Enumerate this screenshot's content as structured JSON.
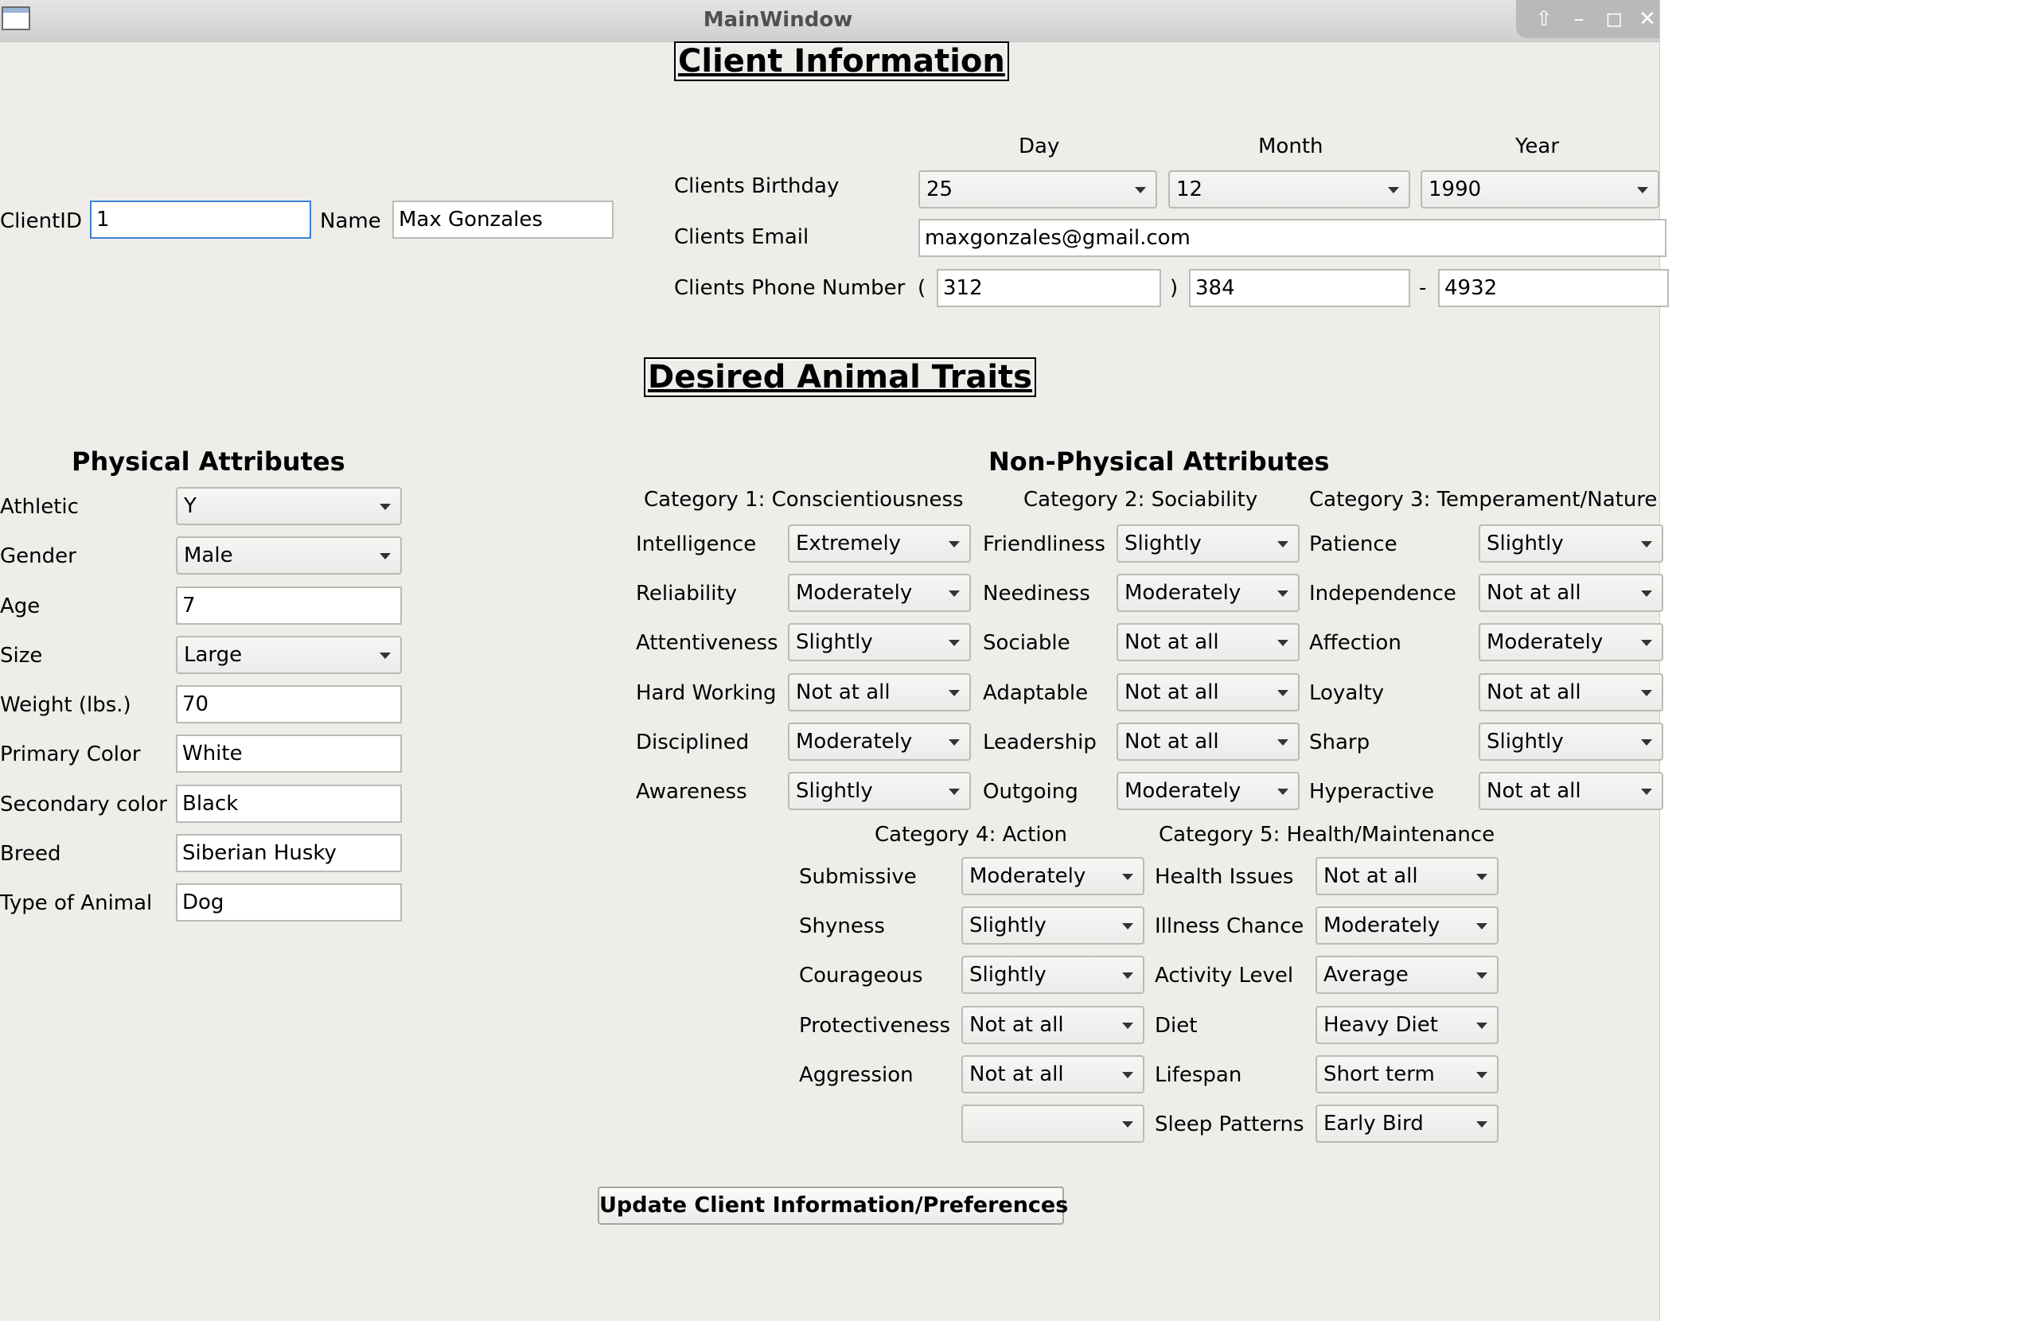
{
  "window": {
    "title": "MainWindow"
  },
  "client_section": {
    "title": "Client Information",
    "client_id_label": "ClientID",
    "client_id_value": "1",
    "name_label": "Name",
    "name_value": "Max Gonzales",
    "day_header": "Day",
    "month_header": "Month",
    "year_header": "Year",
    "birthday_label": "Clients Birthday",
    "birthday_day": "25",
    "birthday_month": "12",
    "birthday_year": "1990",
    "email_label": "Clients Email",
    "email_value": "maxgonzales@gmail.com",
    "phone_label": "Clients Phone Number",
    "phone_open_paren": "(",
    "phone_area": "312",
    "phone_close_paren": ")",
    "phone_prefix": "384",
    "phone_dash": "-",
    "phone_line": "4932"
  },
  "traits_section": {
    "title": "Desired Animal Traits"
  },
  "physical": {
    "title": "Physical Attributes",
    "rows": [
      {
        "label": "Athletic",
        "value": "Y",
        "type": "combo"
      },
      {
        "label": "Gender",
        "value": "Male",
        "type": "combo"
      },
      {
        "label": "Age",
        "value": "7",
        "type": "input"
      },
      {
        "label": "Size",
        "value": "Large",
        "type": "combo"
      },
      {
        "label": "Weight (lbs.)",
        "value": "70",
        "type": "input"
      },
      {
        "label": "Primary Color",
        "value": "White",
        "type": "input"
      },
      {
        "label": "Secondary color",
        "value": "Black",
        "type": "input"
      },
      {
        "label": "Breed",
        "value": "Siberian Husky",
        "type": "input"
      },
      {
        "label": "Type of Animal",
        "value": "Dog",
        "type": "input"
      }
    ]
  },
  "nonphysical": {
    "title": "Non-Physical Attributes",
    "cat1": {
      "title": "Category 1: Conscientiousness",
      "rows": [
        {
          "label": "Intelligence",
          "value": "Extremely"
        },
        {
          "label": "Reliability",
          "value": "Moderately"
        },
        {
          "label": "Attentiveness",
          "value": "Slightly"
        },
        {
          "label": "Hard Working",
          "value": "Not at all"
        },
        {
          "label": "Disciplined",
          "value": "Moderately"
        },
        {
          "label": "Awareness",
          "value": "Slightly"
        }
      ]
    },
    "cat2": {
      "title": "Category 2: Sociability",
      "rows": [
        {
          "label": "Friendliness",
          "value": "Slightly"
        },
        {
          "label": "Neediness",
          "value": "Moderately"
        },
        {
          "label": "Sociable",
          "value": "Not at all"
        },
        {
          "label": "Adaptable",
          "value": "Not at all"
        },
        {
          "label": "Leadership",
          "value": "Not at all"
        },
        {
          "label": "Outgoing",
          "value": "Moderately"
        }
      ]
    },
    "cat3": {
      "title": "Category 3: Temperament/Nature",
      "rows": [
        {
          "label": "Patience",
          "value": "Slightly"
        },
        {
          "label": "Independence",
          "value": "Not at all"
        },
        {
          "label": "Affection",
          "value": "Moderately"
        },
        {
          "label": "Loyalty",
          "value": "Not at all"
        },
        {
          "label": "Sharp",
          "value": "Slightly"
        },
        {
          "label": "Hyperactive",
          "value": "Not at all"
        }
      ]
    },
    "cat4": {
      "title": "Category 4: Action",
      "rows": [
        {
          "label": "Submissive",
          "value": "Moderately"
        },
        {
          "label": "Shyness",
          "value": "Slightly"
        },
        {
          "label": "Courageous",
          "value": "Slightly"
        },
        {
          "label": "Protectiveness",
          "value": "Not at all"
        },
        {
          "label": "Aggression",
          "value": "Not at all"
        },
        {
          "label": "",
          "value": ""
        }
      ]
    },
    "cat5": {
      "title": "Category 5: Health/Maintenance",
      "rows": [
        {
          "label": "Health Issues",
          "value": "Not at all"
        },
        {
          "label": "Illness Chance",
          "value": "Moderately"
        },
        {
          "label": "Activity Level",
          "value": "Average"
        },
        {
          "label": "Diet",
          "value": "Heavy Diet"
        },
        {
          "label": "Lifespan",
          "value": "Short term"
        },
        {
          "label": "Sleep Patterns",
          "value": "Early Bird"
        }
      ]
    }
  },
  "update_button": "Update Client Information/Preferences"
}
